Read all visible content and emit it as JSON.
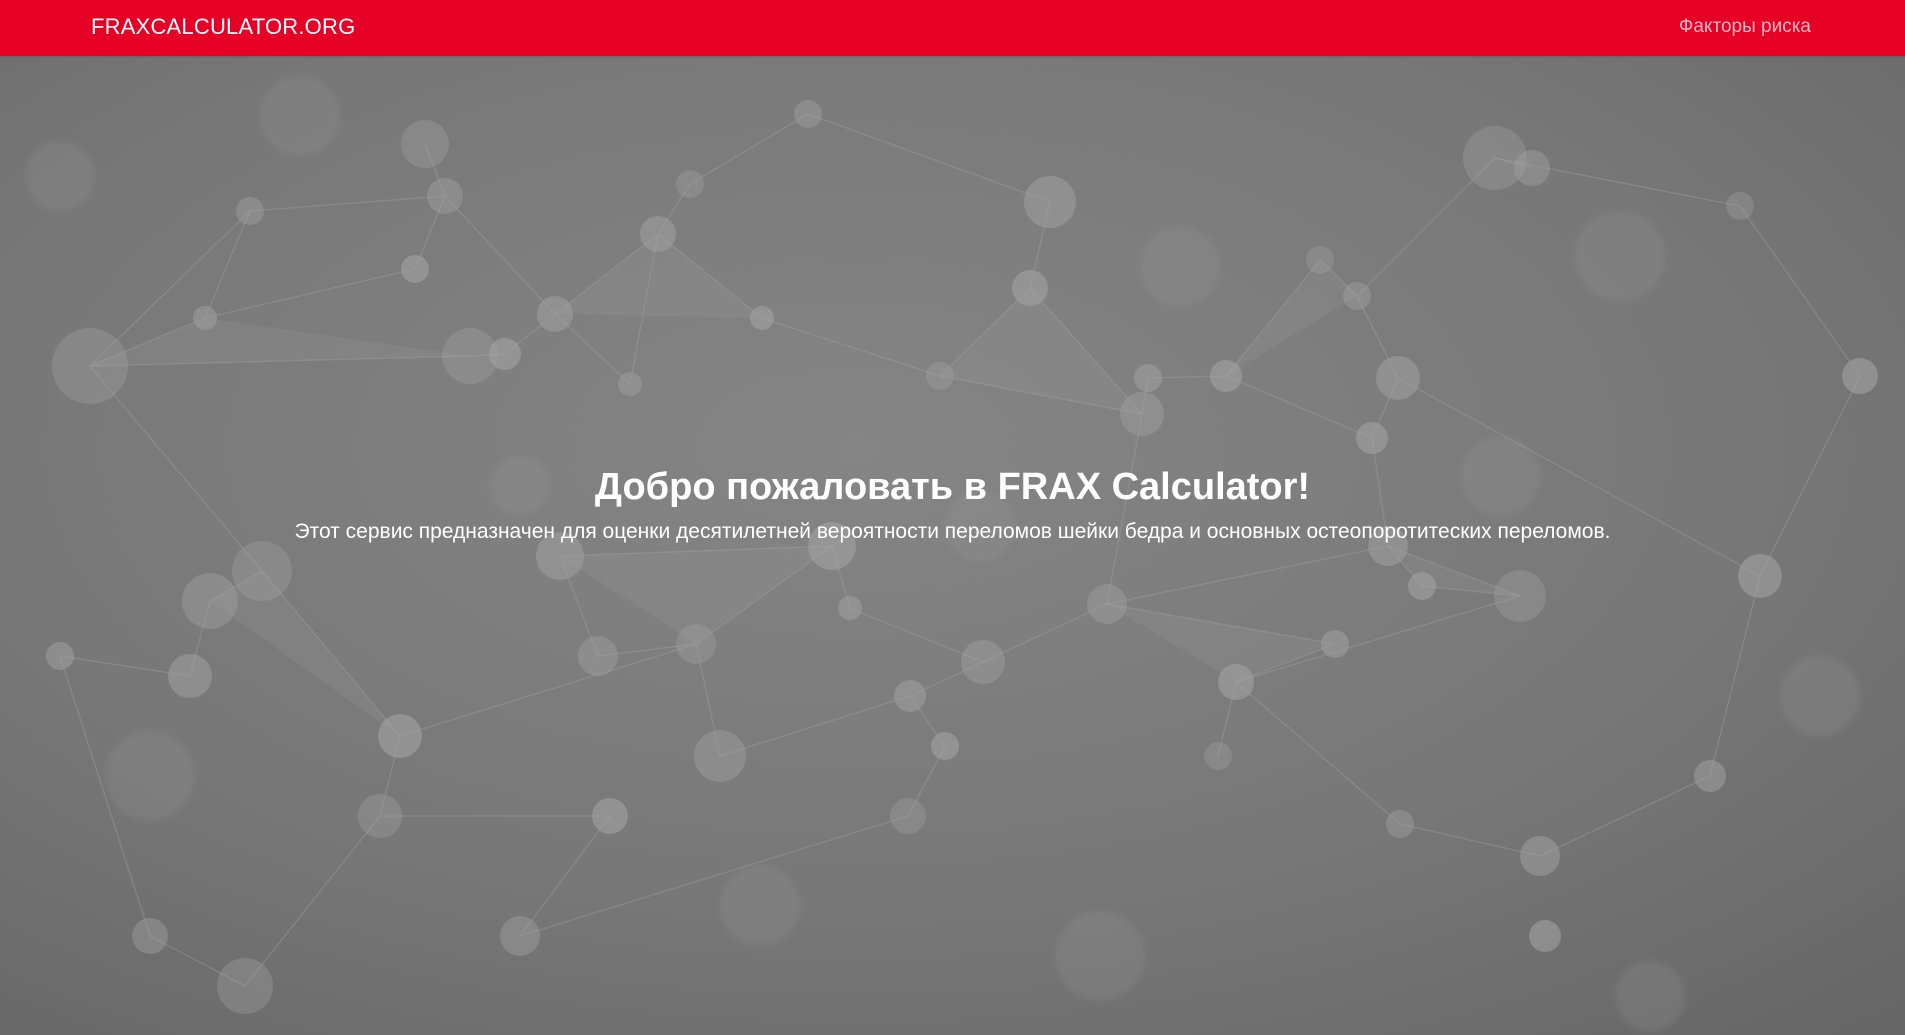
{
  "navbar": {
    "brand": "FRAXCALCULATOR.ORG",
    "link_risk_factors": "Факторы риска",
    "background_color": "#e60026"
  },
  "hero": {
    "title": "Добро пожаловать в FRAX Calculator!",
    "subtitle": "Этот сервис предназначен для оценки десятилетней вероятности переломов шейки бедра и основных остеопоротитеских переломов.",
    "background_style": "grey molecular network pattern"
  }
}
